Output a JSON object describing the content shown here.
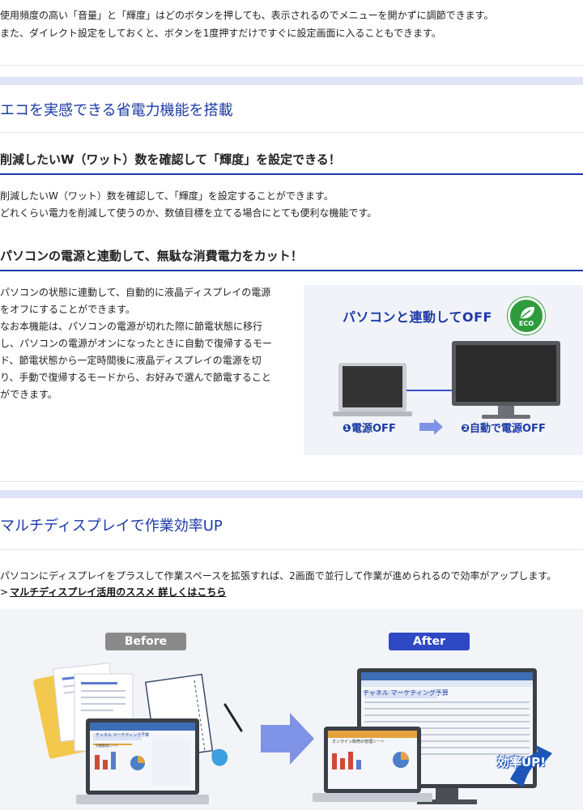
{
  "intro": {
    "line1": "使用頻度の高い「音量」と「輝度」はどのボタンを押しても、表示されるのでメニューを開かずに調節できます。",
    "line2": "また、ダイレクト設定をしておくと、ボタンを1度押すだけですぐに設定画面に入ることもできます。"
  },
  "eco_section": {
    "heading": "エコを実感できる省電力機能を搭載",
    "sub1": {
      "heading": "削減したいW（ワット）数を確認して「輝度」を設定できる！",
      "line1": "削減したいW（ワット）数を確認して、「輝度」を設定することができます。",
      "line2": "どれくらい電力を削減して使うのか、数値目標を立てる場合にとても便利な機能です。"
    },
    "sub2": {
      "heading": "パソコンの電源と連動して、無駄な消費電力をカット！",
      "lines": [
        "パソコンの状態に連動して、自動的に液晶ディスプレイの電源",
        "をオフにすることができます。",
        "なお本機能は、パソコンの電源が切れた際に節電状態に移行",
        "し、パソコンの電源がオンになったときに自動で復帰するモー",
        "ド、節電状態から一定時間後に液晶ディスプレイの電源を切",
        "り、手動で復帰するモードから、お好みで選んで節電すること",
        "ができます。"
      ]
    },
    "figure": {
      "title": "パソコンと連動してOFF",
      "badge": "ECO",
      "step1": "❶電源OFF",
      "step2": "❷自動で電源OFF"
    }
  },
  "multi_section": {
    "heading": "マルチディスプレイで作業効率UP",
    "para": "パソコンにディスプレイをプラスして作業スペースを拡張すれば、2画面で並行して作業が進められるので効率がアップします。",
    "link_arrow": ">",
    "link_text": "マルチディスプレイ活用のススメ 詳しくはこちら",
    "figure": {
      "before_label": "Before",
      "after_label": "After",
      "screen_title_before": "チャネル マーケティング予算",
      "screen_title_after": "チャネル マーケティング予算",
      "sheet_title": "オンライン販売の管理シート",
      "sheet_title_before": "分類管理シート",
      "badge": "効率UP!"
    }
  },
  "colors": {
    "accent": "#1d3aa8",
    "band": "#dfe3f6",
    "eco_green": "#2f9c3c",
    "before_pill": "#8a8a8a",
    "after_pill": "#2f49c4"
  }
}
